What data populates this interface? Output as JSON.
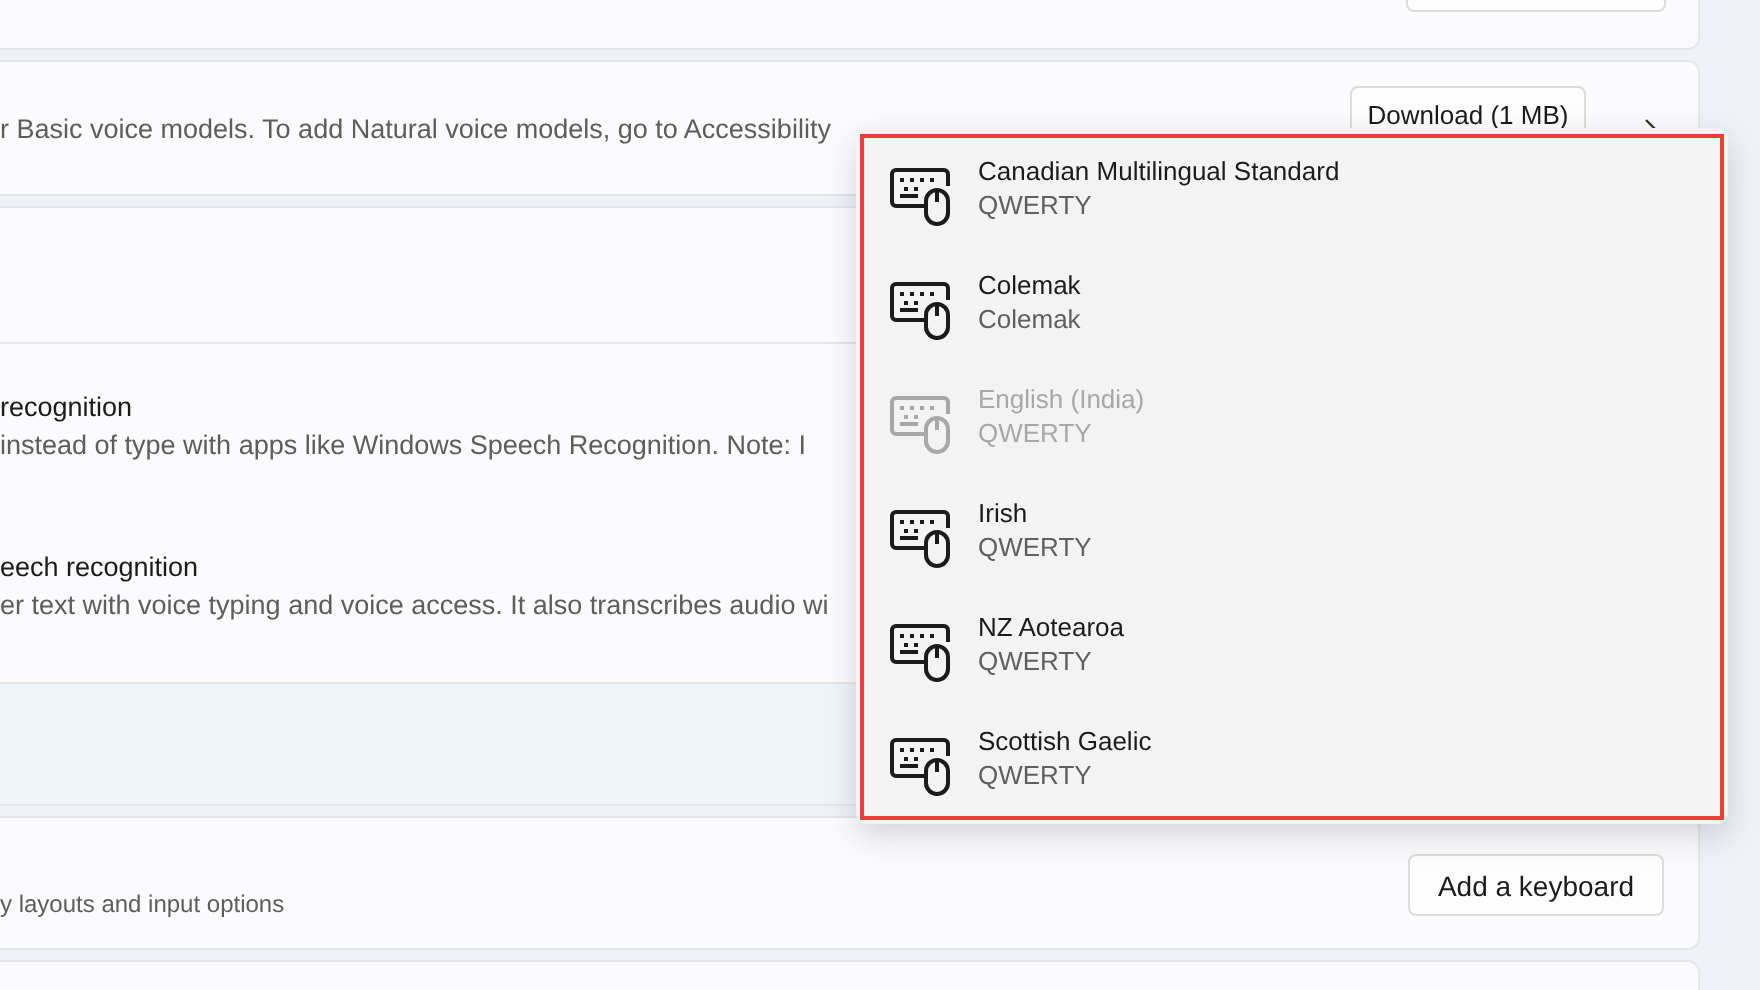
{
  "voice_card": {
    "description": "r Basic voice models. To add Natural voice models, go to Accessibility",
    "download_button": "Download (1 MB)"
  },
  "speech_rows": [
    {
      "title": "recognition",
      "description": "instead of type with apps like Windows Speech Recognition. Note: I"
    },
    {
      "title": "eech recognition",
      "description": "er text with voice typing and voice access. It also transcribes audio wi"
    }
  ],
  "keyboard_card": {
    "description": "y layouts and input options",
    "add_button": "Add a keyboard"
  },
  "layout_menu": {
    "items": [
      {
        "name": "Canadian Multilingual Standard",
        "layout": "QWERTY",
        "disabled": false
      },
      {
        "name": "Colemak",
        "layout": "Colemak",
        "disabled": false
      },
      {
        "name": "English (India)",
        "layout": "QWERTY",
        "disabled": true
      },
      {
        "name": "Irish",
        "layout": "QWERTY",
        "disabled": false
      },
      {
        "name": "NZ Aotearoa",
        "layout": "QWERTY",
        "disabled": false
      },
      {
        "name": "Scottish Gaelic",
        "layout": "QWERTY",
        "disabled": false
      }
    ]
  }
}
